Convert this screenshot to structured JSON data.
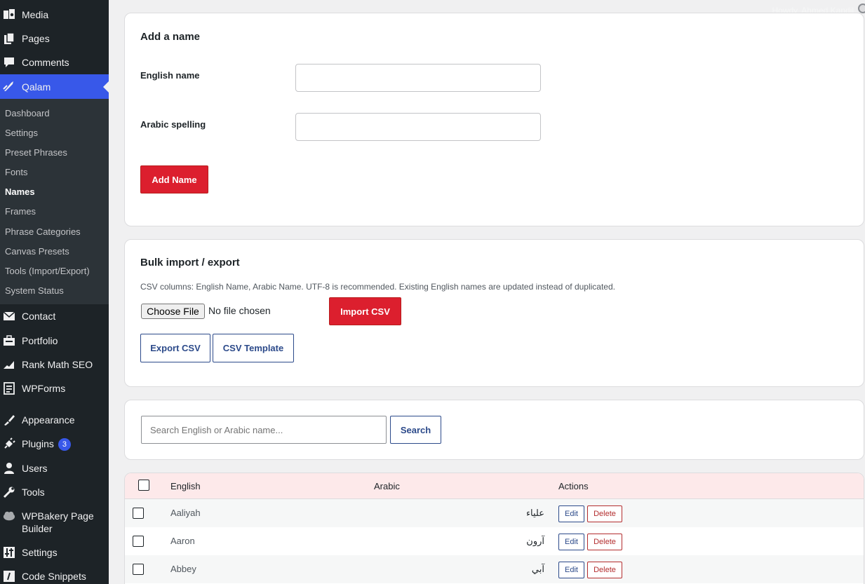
{
  "admin_bar": {
    "howdy": "Howdy, Ahmed Kandil"
  },
  "sidebar": {
    "items": [
      {
        "label": "Media",
        "icon": "media-icon"
      },
      {
        "label": "Pages",
        "icon": "pages-icon"
      },
      {
        "label": "Comments",
        "icon": "comments-icon"
      },
      {
        "label": "Qalam",
        "icon": "qalam-icon"
      },
      {
        "label": "Contact",
        "icon": "mail-icon"
      },
      {
        "label": "Portfolio",
        "icon": "portfolio-icon"
      },
      {
        "label": "Rank Math SEO",
        "icon": "rank-math-icon"
      },
      {
        "label": "WPForms",
        "icon": "wpforms-icon"
      },
      {
        "label": "Appearance",
        "icon": "appearance-icon"
      },
      {
        "label": "Plugins",
        "icon": "plugins-icon",
        "badge": "3"
      },
      {
        "label": "Users",
        "icon": "users-icon"
      },
      {
        "label": "Tools",
        "icon": "tools-icon"
      },
      {
        "label": "WPBakery Page\nBuilder",
        "icon": "wpbakery-icon"
      },
      {
        "label": "Settings",
        "icon": "settings-icon"
      },
      {
        "label": "Code Snippets",
        "icon": "code-snippets-icon"
      }
    ],
    "submenu": [
      "Dashboard",
      "Settings",
      "Preset Phrases",
      "Fonts",
      "Names",
      "Frames",
      "Phrase Categories",
      "Canvas Presets",
      "Tools (Import/Export)",
      "System Status"
    ],
    "current_submenu": "Names"
  },
  "add_name": {
    "title": "Add a name",
    "english_label": "English name",
    "english_value": "",
    "arabic_label": "Arabic spelling",
    "arabic_value": "",
    "submit_label": "Add Name"
  },
  "bulk": {
    "title": "Bulk import / export",
    "help": "CSV columns: English Name, Arabic Name. UTF-8 is recommended. Existing English names are updated instead of duplicated.",
    "choose_file": "Choose File",
    "no_file": "No file chosen",
    "import_label": "Import CSV",
    "export_label": "Export CSV",
    "template_label": "CSV Template"
  },
  "search": {
    "placeholder": "Search English or Arabic name...",
    "button": "Search"
  },
  "table": {
    "headers": {
      "english": "English",
      "arabic": "Arabic",
      "actions": "Actions"
    },
    "edit_label": "Edit",
    "delete_label": "Delete",
    "rows": [
      {
        "english": "Aaliyah",
        "arabic": "علياء"
      },
      {
        "english": "Aaron",
        "arabic": "آرون"
      },
      {
        "english": "Abbey",
        "arabic": "آبي"
      }
    ]
  },
  "colors": {
    "accent": "#3858e9",
    "primary_button": "#dc1f2e",
    "sidebar_bg": "#1d2327"
  }
}
